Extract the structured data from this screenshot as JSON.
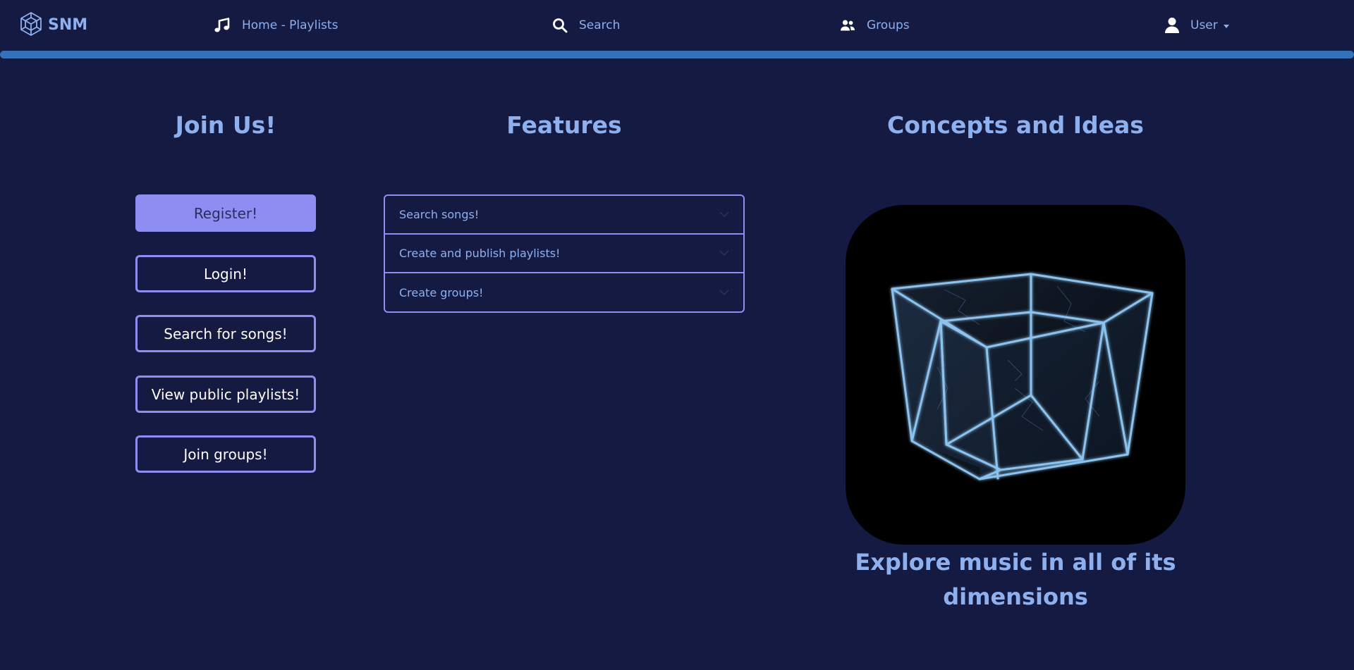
{
  "navbar": {
    "brand": "SNM",
    "home_label": "Home - Playlists",
    "search_label": "Search",
    "groups_label": "Groups",
    "user_label": "User",
    "icons": {
      "brand": "cube-logo-icon",
      "home": "music-note-icon",
      "search": "search-icon",
      "groups": "users-icon",
      "user": "user-icon"
    }
  },
  "join": {
    "heading": "Join Us!",
    "buttons": {
      "register": "Register!",
      "login": "Login!",
      "search_songs": "Search for songs!",
      "public_playlists": "View public playlists!",
      "join_groups": "Join groups!"
    }
  },
  "features": {
    "heading": "Features",
    "items": [
      {
        "label": "Search songs!"
      },
      {
        "label": "Create and publish playlists!"
      },
      {
        "label": "Create groups!"
      }
    ]
  },
  "concepts": {
    "heading": "Concepts and Ideas",
    "image": "tesseract-cube-image",
    "caption": "Explore music in all of its dimensions"
  },
  "colors": {
    "background": "#141a42",
    "accent": "#8e8ef2",
    "text": "#8fb0ee",
    "navbar_bar": "#3571b8"
  }
}
